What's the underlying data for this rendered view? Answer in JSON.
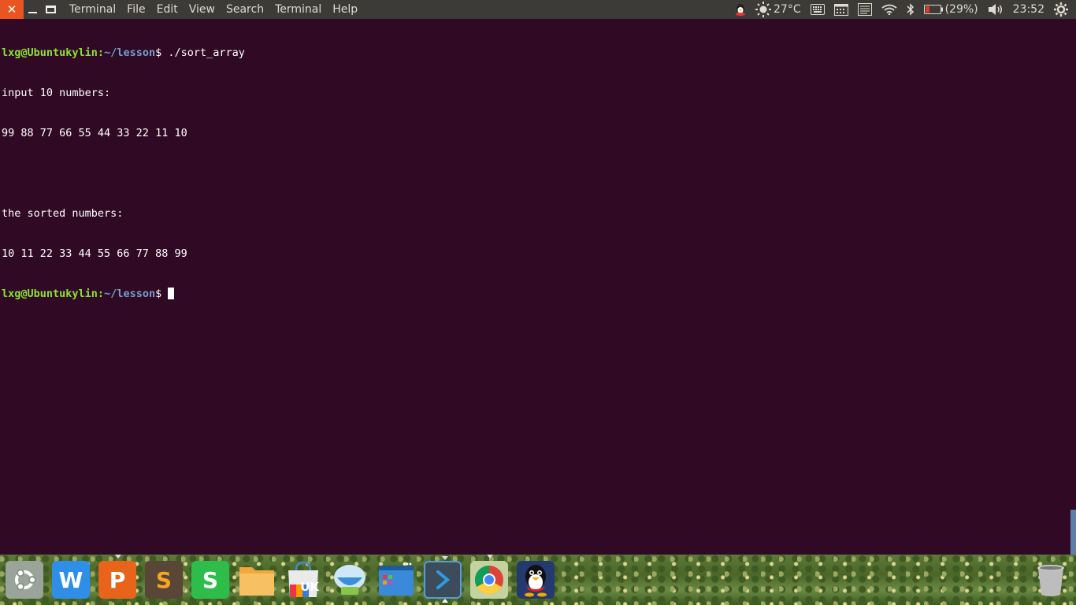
{
  "top_panel": {
    "menu": [
      "Terminal",
      "File",
      "Edit",
      "View",
      "Search",
      "Terminal",
      "Help"
    ],
    "weather": "27°C",
    "battery": "(29%)",
    "clock": "23:52"
  },
  "terminal": {
    "prompt_user": "lxg@Ubuntukylin",
    "prompt_path": "~/lesson",
    "prompt_symbol": "$",
    "command": " ./sort_array",
    "output": [
      "input 10 numbers:",
      "99 88 77 66 55 44 33 22 11 10",
      "",
      "the sorted numbers:",
      "10 11 22 33 44 55 66 77 88 99"
    ]
  },
  "dock": {
    "items": [
      {
        "name": "ubuntu-dash-icon",
        "letter": ""
      },
      {
        "name": "wps-writer-icon",
        "letter": "W"
      },
      {
        "name": "wps-presentation-icon",
        "letter": "P"
      },
      {
        "name": "sublime-text-icon",
        "letter": "S"
      },
      {
        "name": "wps-spreadsheets-icon",
        "letter": "S"
      },
      {
        "name": "files-icon",
        "letter": ""
      },
      {
        "name": "software-center-icon",
        "letter": "UK"
      },
      {
        "name": "system-tool-icon",
        "letter": ""
      },
      {
        "name": "workspaces-icon",
        "letter": ""
      },
      {
        "name": "terminal-icon",
        "letter": ""
      },
      {
        "name": "chrome-icon",
        "letter": ""
      },
      {
        "name": "qq-icon",
        "letter": ""
      },
      {
        "name": "trash-icon",
        "letter": ""
      }
    ]
  },
  "colors": {
    "terminal_bg": "#300a24",
    "prompt_user": "#8ae234",
    "prompt_path": "#729fcf",
    "panel_bg": "#3c3b37",
    "close_btn": "#e95420"
  }
}
